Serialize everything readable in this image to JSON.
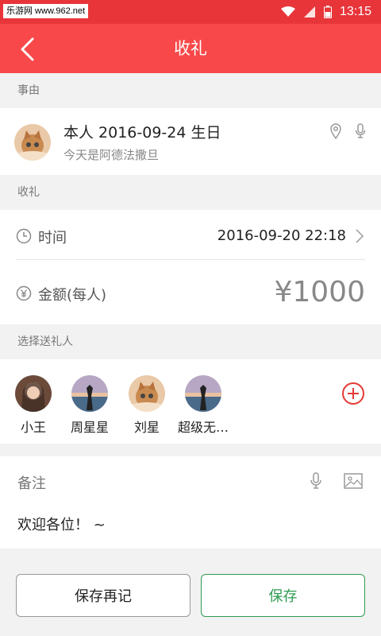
{
  "status_bar": {
    "watermark": "乐游网 www.962.net",
    "time": "13:15"
  },
  "nav": {
    "title": "收礼",
    "back_icon": "chevron-left-icon"
  },
  "event_section": {
    "header": "事由",
    "title": "本人 2016-09-24 生日",
    "description": "今天是阿德法撒旦",
    "icons": [
      "location-pin-icon",
      "microphone-icon"
    ]
  },
  "gift_section": {
    "header": "收礼",
    "time_label": "时间",
    "time_value": "2016-09-20  22:18",
    "amount_label": "金额(每人)",
    "amount_value": "¥1000"
  },
  "givers_section": {
    "header": "选择送礼人",
    "givers": [
      {
        "name": "小王",
        "avatar": "girl-portrait"
      },
      {
        "name": "周星星",
        "avatar": "beach-silhouette"
      },
      {
        "name": "刘星",
        "avatar": "kitten"
      },
      {
        "name": "超级无…",
        "avatar": "beach-silhouette"
      }
    ],
    "add_icon": "add-circle-icon"
  },
  "note_section": {
    "label": "备注",
    "text": "欢迎各位！ ~",
    "icons": [
      "microphone-icon",
      "image-icon"
    ]
  },
  "actions": {
    "save_again": "保存再记",
    "save": "保存"
  },
  "colors": {
    "primary_red": "#f8484a",
    "status_red": "#e8353a",
    "green": "#2e9b52",
    "add_red": "#e53935"
  }
}
